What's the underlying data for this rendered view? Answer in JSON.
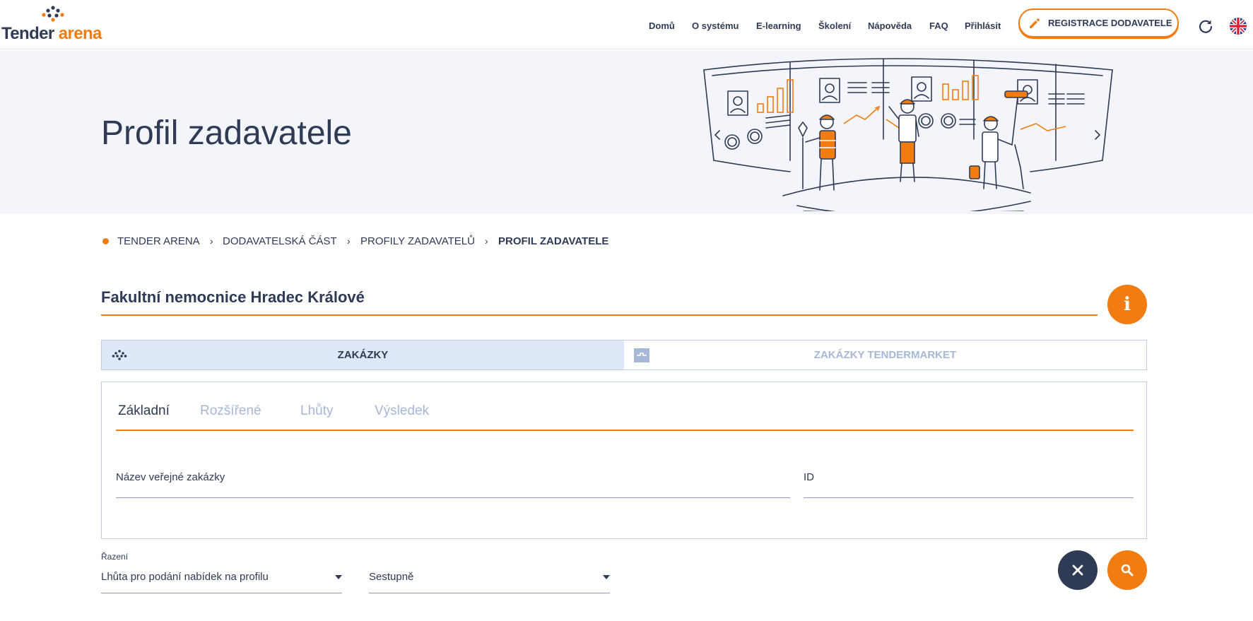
{
  "header": {
    "logo": {
      "word1": "Tender",
      "word2": "arena"
    },
    "nav": [
      "Domů",
      "O systému",
      "E-learning",
      "Školení",
      "Nápověda",
      "FAQ",
      "Přihlásit"
    ],
    "register_label": "REGISTRACE DODAVATELE",
    "icons": {
      "register": "pencil-icon",
      "refresh": "refresh-icon",
      "language": "uk-flag-icon"
    }
  },
  "hero": {
    "title": "Profil zadavatele"
  },
  "breadcrumb": [
    "TENDER ARENA",
    "DODAVATELSKÁ ČÁST",
    "PROFILY ZADAVATELŮ",
    "PROFIL ZADAVATELE"
  ],
  "org": {
    "name": "Fakultní nemocnice Hradec Králové",
    "info_icon": "i"
  },
  "main_tabs": [
    {
      "label": "ZAKÁZKY",
      "active": true
    },
    {
      "label": "ZAKÁZKY TENDERMARKET",
      "active": false
    }
  ],
  "filter": {
    "tabs": [
      {
        "label": "Základní",
        "active": true
      },
      {
        "label": "Rozšířené",
        "active": false
      },
      {
        "label": "Lhůty",
        "active": false
      },
      {
        "label": "Výsledek",
        "active": false
      }
    ],
    "fields": {
      "name": "Název veřejné zakázky",
      "id": "ID"
    }
  },
  "sort": {
    "label": "Řazení",
    "by": "Lhůta pro podání nabídek na profilu",
    "order": "Sestupně"
  },
  "colors": {
    "accent": "#f07c12",
    "navy": "#2f3a55",
    "muted": "#a7b7d6",
    "active_tab": "#dfe8f8"
  }
}
